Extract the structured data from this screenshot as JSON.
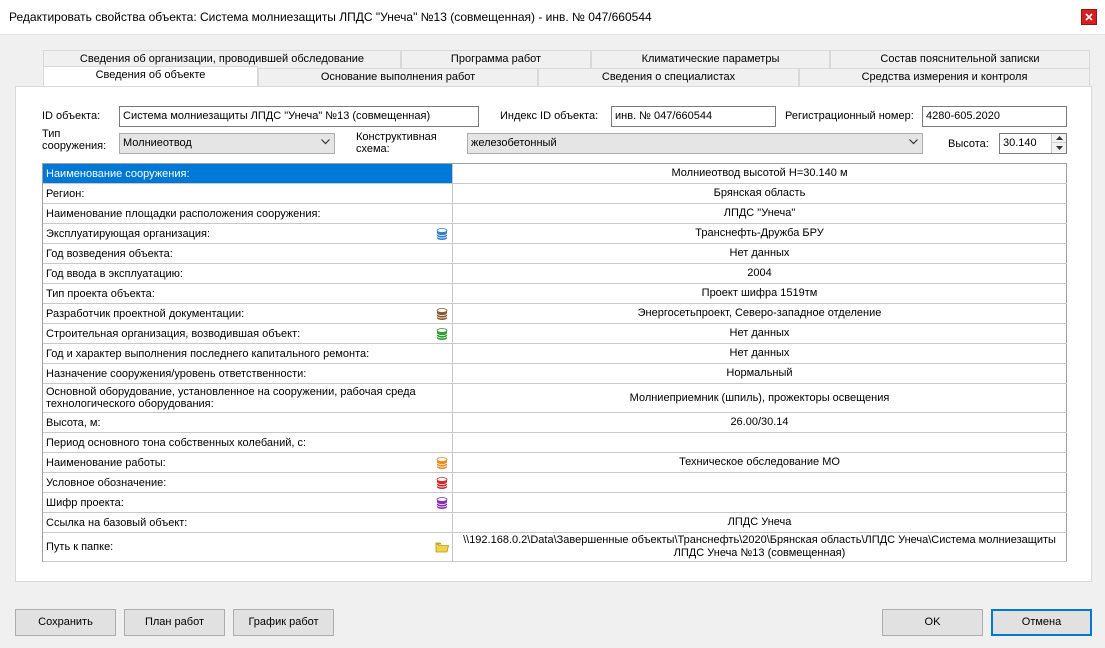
{
  "window": {
    "title": "Редактировать свойства объекта: Система молниезащиты ЛПДС \"Унеча\" №13 (совмещенная) - инв. № 047/660544"
  },
  "tabs": {
    "back_row": [
      "Сведения об организации, проводившей обследование",
      "Программа работ",
      "Климатические параметры",
      "Состав пояснительной записки"
    ],
    "front_row": [
      "Сведения об объекте",
      "Основание выполнения работ",
      "Сведения о специалистах",
      "Средства измерения и контроля"
    ],
    "active": "Сведения об объекте"
  },
  "form": {
    "id_label": "ID объекта:",
    "id_value": "Система молниезащиты ЛПДС \"Унеча\" №13 (совмещенная)",
    "index_label": "Индекс ID объекта:",
    "index_value": "инв. № 047/660544",
    "reg_label": "Регистрационный номер:",
    "reg_value": "4280-605.2020",
    "type_label_1": "Тип",
    "type_label_2": "сооружения:",
    "type_value": "Молниеотвод",
    "scheme_label_1": "Конструктивная",
    "scheme_label_2": "схема:",
    "scheme_value": "железобетонный",
    "height_label": "Высота:",
    "height_value": "30.140"
  },
  "grid": {
    "rows": [
      {
        "name": "Наименование сооружения:",
        "value": "Молниеотвод высотой Н=30.140 м",
        "icon": "",
        "selected": true
      },
      {
        "name": "Регион:",
        "value": "Брянская область",
        "icon": ""
      },
      {
        "name": "Наименование площадки расположения сооружения:",
        "value": "ЛПДС \"Унеча\"",
        "icon": ""
      },
      {
        "name": "Эксплуатирующая организация:",
        "value": "Транснефть-Дружба БРУ",
        "icon": "database-blue-icon"
      },
      {
        "name": "Год возведения объекта:",
        "value": "Нет данных",
        "icon": ""
      },
      {
        "name": "Год ввода в эксплуатацию:",
        "value": "2004",
        "icon": ""
      },
      {
        "name": "Тип проекта объекта:",
        "value": "Проект шифра 1519тм",
        "icon": ""
      },
      {
        "name": "Разработчик проектной документации:",
        "value": "Энергосетьпроект, Северо-западное отделение",
        "icon": "database-brown-icon"
      },
      {
        "name": "Строительная организация, возводившая объект:",
        "value": "Нет данных",
        "icon": "database-green-icon"
      },
      {
        "name": "Год и характер выполнения последнего капитального ремонта:",
        "value": "Нет данных",
        "icon": ""
      },
      {
        "name": "Назначение сооружения/уровень ответственности:",
        "value": "Нормальный",
        "icon": ""
      },
      {
        "name": "Основной оборудование, установленное на сооружении, рабочая среда технологического оборудования:",
        "value": "Молниеприемник (шпиль), прожекторы освещения",
        "icon": "",
        "tall": true
      },
      {
        "name": "Высота, м:",
        "value": "26.00/30.14",
        "icon": ""
      },
      {
        "name": "Период основного тона собственных колебаний, с:",
        "value": "",
        "icon": ""
      },
      {
        "name": "Наименование работы:",
        "value": "Техническое обследование МО",
        "icon": "database-orange-icon"
      },
      {
        "name": "Условное обозначение:",
        "value": "",
        "icon": "database-red-icon"
      },
      {
        "name": "Шифр проекта:",
        "value": "",
        "icon": "database-purple-icon"
      },
      {
        "name": "Ссылка на базовый объект:",
        "value": "ЛПДС Унеча",
        "icon": ""
      },
      {
        "name": "Путь к папке:",
        "value": "\\\\192.168.0.2\\Data\\Завершенные объекты\\Транснефть\\2020\\Брянская область\\ЛПДС Унеча\\Система молниезащиты ЛПДС Унеча №13 (совмещенная)",
        "icon": "folder-icon",
        "tall": true
      }
    ]
  },
  "buttons": {
    "save": "Сохранить",
    "plan": "План работ",
    "schedule": "График работ",
    "ok": "OK",
    "cancel": "Отмена"
  },
  "colors": {
    "selection": "#0078d7",
    "close": "#d42020",
    "database-blue-icon": "#2f7fd6",
    "database-brown-icon": "#8b5a2b",
    "database-green-icon": "#2e9e2e",
    "database-orange-icon": "#f08a1c",
    "database-red-icon": "#d62828",
    "database-purple-icon": "#8a2bb8",
    "folder-icon": "#f2d24a"
  }
}
